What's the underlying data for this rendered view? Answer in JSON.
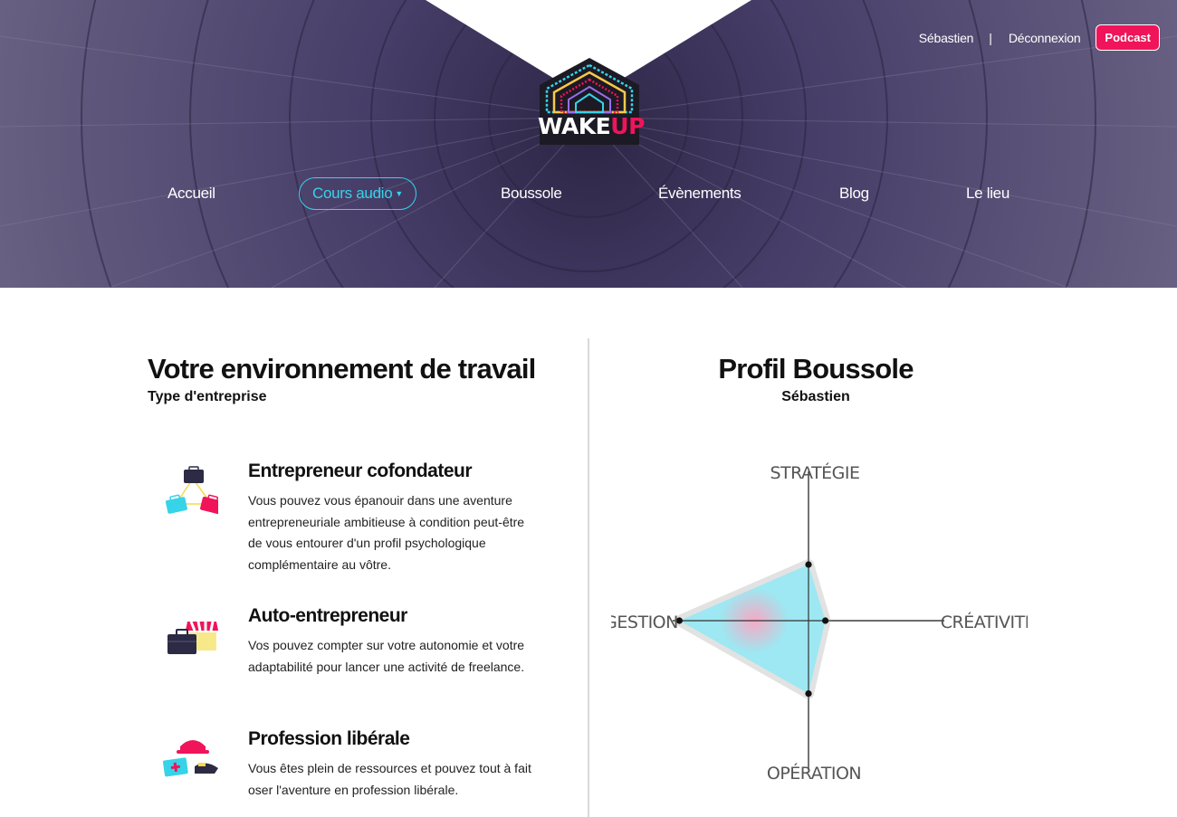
{
  "header": {
    "user_name": "Sébastien",
    "separator": "|",
    "logout_label": "Déconnexion",
    "podcast_label": "Podcast",
    "logo": {
      "word1": "WAKE",
      "word2": "UP"
    },
    "nav": [
      {
        "label": "Accueil"
      },
      {
        "label": "Cours audio",
        "active": true
      },
      {
        "label": "Boussole"
      },
      {
        "label": "Évènements"
      },
      {
        "label": "Blog"
      },
      {
        "label": "Le lieu"
      }
    ]
  },
  "left": {
    "title": "Votre environnement de travail",
    "subtitle": "Type d'entreprise",
    "items": [
      {
        "title": "Entrepreneur cofondateur",
        "description": "Vous pouvez vous épanouir dans une aventure entrepreneuriale ambitieuse à condition peut-être de vous entourer d'un profil psychologique complémentaire au vôtre.",
        "icon": "briefcases-network-icon"
      },
      {
        "title": "Auto-entrepreneur",
        "description": "Vos pouvez compter sur votre autonomie et votre adaptabilité pour lancer une activité de freelance.",
        "icon": "shop-briefcase-icon"
      },
      {
        "title": "Profession libérale",
        "description": "Vous êtes plein de ressources et pouvez tout à fait oser l'aventure en profession libérale.",
        "icon": "professional-hats-icon"
      }
    ]
  },
  "right": {
    "title": "Profil Boussole",
    "subtitle": "Sébastien",
    "chart_data": {
      "type": "radar",
      "axes": [
        "STRATÉGIE",
        "CRÉATIVITÉ",
        "OPÉRATION",
        "GESTION"
      ],
      "values": [
        0.4,
        0.12,
        0.52,
        0.92
      ],
      "range": [
        0,
        1
      ],
      "colors": {
        "fill": "#9de8f2",
        "border": "#e2e2e2",
        "center_glow": "#f7a9c4"
      }
    }
  },
  "colors": {
    "accent_cyan": "#37d3e8",
    "accent_pink": "#f0145a",
    "hero_purple": "#3b3358"
  }
}
